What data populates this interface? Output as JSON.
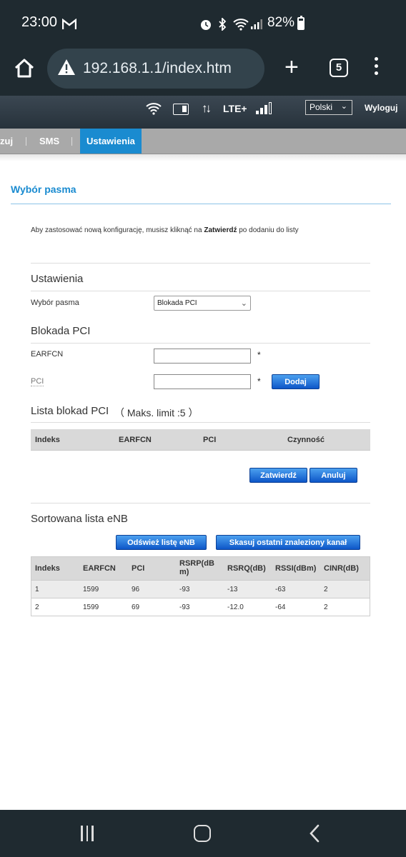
{
  "status_bar": {
    "time": "23:00",
    "battery_pct": "82%"
  },
  "browser": {
    "url": "192.168.1.1/index.htm",
    "tab_count": "5"
  },
  "router_header": {
    "network_type": "LTE+",
    "language": "Polski",
    "logout": "Wyloguj"
  },
  "nav": {
    "items": [
      "zuj",
      "SMS",
      "Ustawienia"
    ],
    "active": "Ustawienia"
  },
  "page": {
    "title": "Wybór pasma",
    "info_prefix": "Aby zastosować nową konfigurację, musisz kliknąć na ",
    "info_bold": "Zatwierdź",
    "info_suffix": " po dodaniu do listy"
  },
  "settings": {
    "section_title": "Ustawienia",
    "band_label": "Wybór pasma",
    "band_value": "Blokada PCI"
  },
  "pci_lock": {
    "section_title": "Blokada PCI",
    "earfcn_label": "EARFCN",
    "earfcn_value": "",
    "pci_label": "PCI",
    "pci_value": "",
    "required_mark": "*",
    "add_button": "Dodaj"
  },
  "lock_list": {
    "title": "Lista blokad PCI",
    "limit": "（ Maks. limit :5 ）",
    "columns": [
      "Indeks",
      "EARFCN",
      "PCI",
      "Czynność"
    ],
    "rows": [],
    "apply_button": "Zatwierdź",
    "cancel_button": "Anuluj"
  },
  "enb_list": {
    "title": "Sortowana lista eNB",
    "refresh_button": "Odśwież listę eNB",
    "clear_button": "Skasuj ostatni znaleziony kanał",
    "columns": [
      "Indeks",
      "EARFCN",
      "PCI",
      "RSRP(dB m)",
      "RSRQ(dB)",
      "RSSI(dBm)",
      "CINR(dB)"
    ],
    "rows": [
      [
        "1",
        "1599",
        "96",
        "-93",
        "-13",
        "-63",
        "2"
      ],
      [
        "2",
        "1599",
        "69",
        "-93",
        "-12.0",
        "-64",
        "2"
      ]
    ]
  }
}
